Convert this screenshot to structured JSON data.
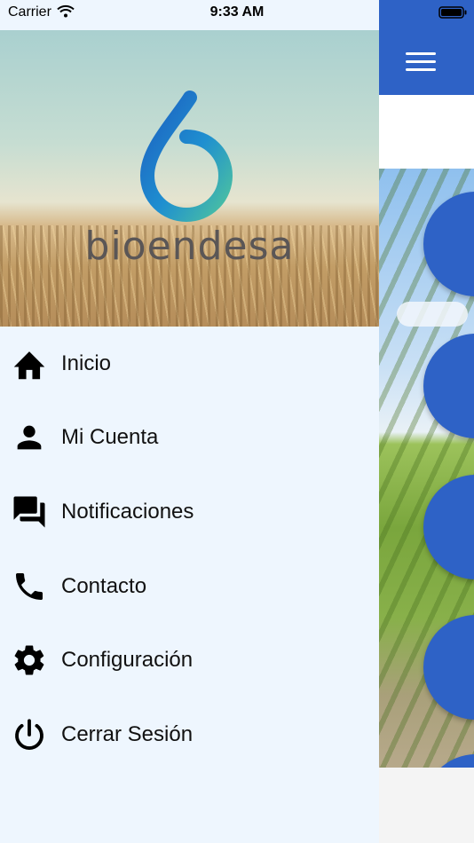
{
  "status_bar": {
    "carrier": "Carrier",
    "time": "9:33 AM"
  },
  "drawer": {
    "brand": "bioendesa",
    "items": [
      {
        "label": "Inicio",
        "icon": "home-icon"
      },
      {
        "label": "Mi Cuenta",
        "icon": "person-icon"
      },
      {
        "label": "Notificaciones",
        "icon": "chat-bubbles-icon"
      },
      {
        "label": "Contacto",
        "icon": "phone-icon"
      },
      {
        "label": "Configuración",
        "icon": "gear-icon"
      },
      {
        "label": "Cerrar Sesión",
        "icon": "power-icon"
      }
    ]
  },
  "colors": {
    "header_blue": "#2e62c6",
    "drawer_bg": "#eef6fe",
    "logo_blue": "#1c72c8",
    "logo_green": "#3fb6a8"
  }
}
